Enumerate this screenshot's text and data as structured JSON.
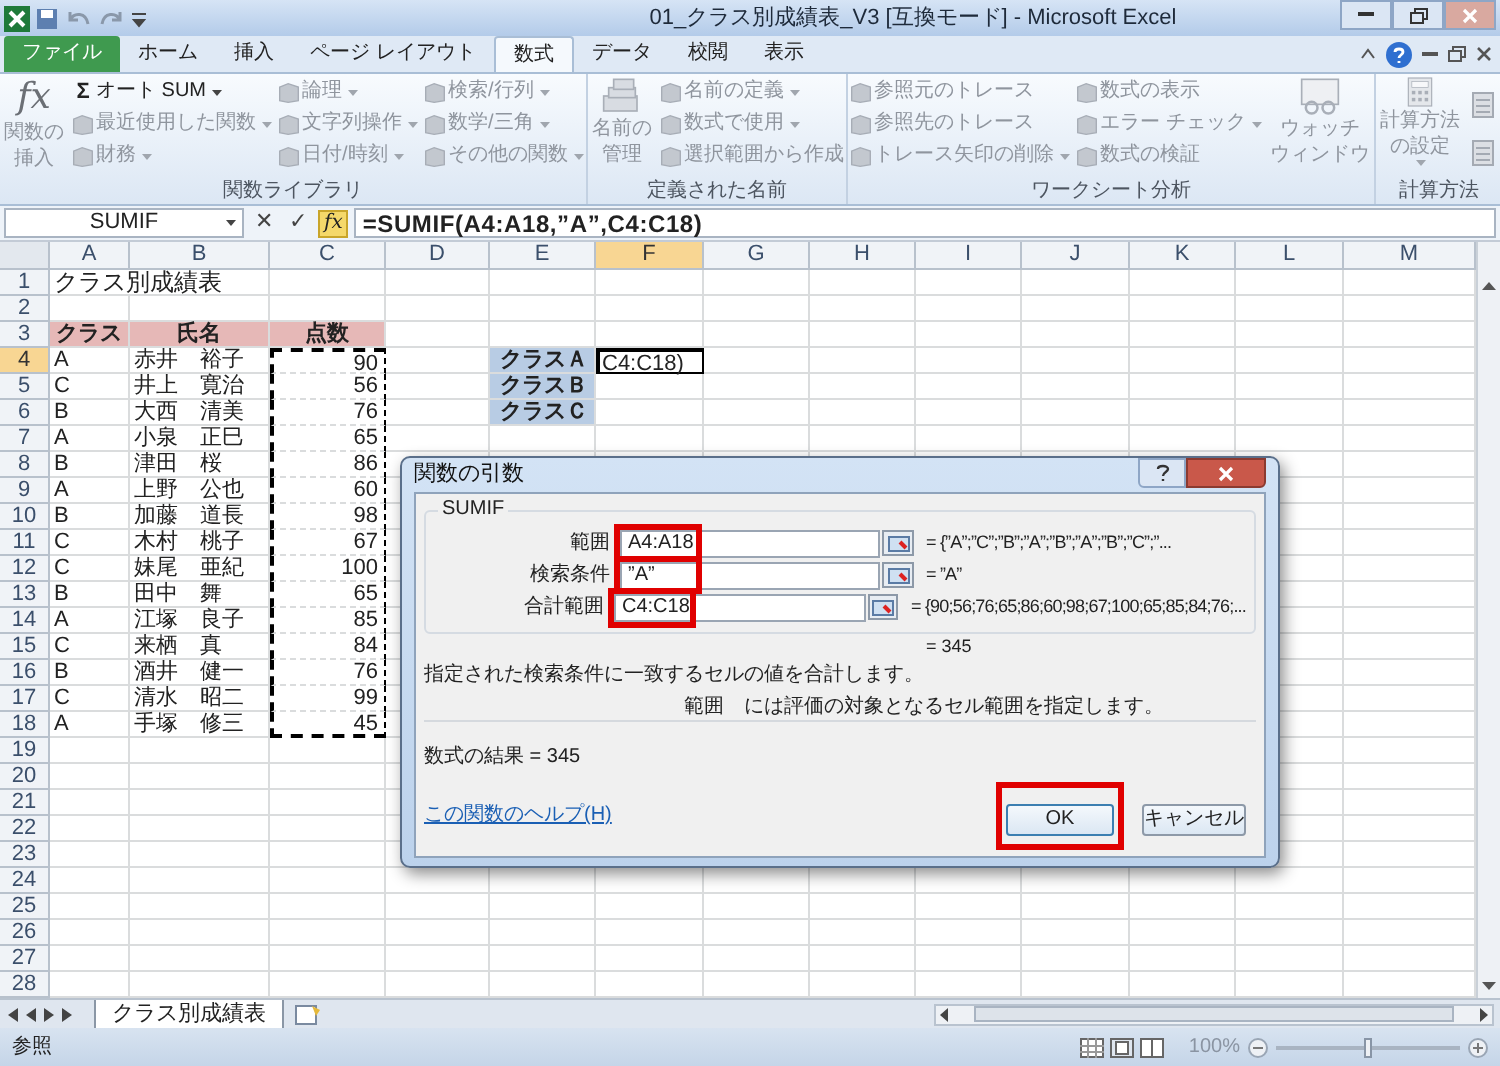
{
  "window": {
    "title": "01_クラス別成績表_V3 [互換モード] - Microsoft Excel"
  },
  "ribbon_tabs": [
    {
      "label": "ファイル",
      "kind": "file",
      "selected": false
    },
    {
      "label": "ホーム",
      "kind": "tab",
      "selected": false
    },
    {
      "label": "挿入",
      "kind": "tab",
      "selected": false
    },
    {
      "label": "ページ レイアウト",
      "kind": "tab",
      "selected": false
    },
    {
      "label": "数式",
      "kind": "tab",
      "selected": true
    },
    {
      "label": "データ",
      "kind": "tab",
      "selected": false
    },
    {
      "label": "校閲",
      "kind": "tab",
      "selected": false
    },
    {
      "label": "表示",
      "kind": "tab",
      "selected": false
    }
  ],
  "ribbon_groups": [
    {
      "label": "関数ライブラリ",
      "columns": [
        [
          {
            "kind": "function",
            "symbol": "fx",
            "label": [
              "関数の",
              "挿入"
            ],
            "disabled": true
          }
        ],
        [
          {
            "kind": "small",
            "symbol": "Σ",
            "label": "オート SUM",
            "dropdown": true,
            "disabled": false
          },
          {
            "kind": "small",
            "label": "最近使用した関数",
            "dropdown": true,
            "disabled": true
          },
          {
            "kind": "small",
            "label": "財務",
            "dropdown": true,
            "disabled": true
          }
        ],
        [
          {
            "kind": "small",
            "label": "論理",
            "dropdown": true,
            "disabled": true
          },
          {
            "kind": "small",
            "label": "文字列操作",
            "dropdown": true,
            "disabled": true
          },
          {
            "kind": "small",
            "label": "日付/時刻",
            "dropdown": true,
            "disabled": true
          }
        ],
        [
          {
            "kind": "small",
            "label": "検索/行列",
            "dropdown": true,
            "disabled": true
          },
          {
            "kind": "small",
            "label": "数学/三角",
            "dropdown": true,
            "disabled": true
          },
          {
            "kind": "small",
            "label": "その他の関数",
            "dropdown": true,
            "disabled": true
          }
        ]
      ]
    },
    {
      "label": "定義された名前",
      "columns": [
        [
          {
            "kind": "names",
            "label": [
              "名前の",
              "管理"
            ],
            "disabled": true
          }
        ],
        [
          {
            "kind": "small",
            "label": "名前の定義",
            "dropdown": true,
            "disabled": true
          },
          {
            "kind": "small",
            "label": "数式で使用",
            "dropdown": true,
            "disabled": true
          },
          {
            "kind": "small",
            "label": "選択範囲から作成",
            "disabled": true
          }
        ]
      ]
    },
    {
      "label": "ワークシート分析",
      "columns": [
        [
          {
            "kind": "small",
            "label": "参照元のトレース",
            "disabled": true
          },
          {
            "kind": "small",
            "label": "参照先のトレース",
            "disabled": true
          },
          {
            "kind": "small",
            "label": "トレース矢印の削除",
            "dropdown": true,
            "disabled": true
          }
        ],
        [
          {
            "kind": "small",
            "label": "数式の表示",
            "disabled": true
          },
          {
            "kind": "small",
            "label": "エラー チェック",
            "dropdown": true,
            "disabled": true
          },
          {
            "kind": "small",
            "label": "数式の検証",
            "disabled": true
          }
        ],
        [
          {
            "kind": "watch",
            "label": [
              "ウォッチ",
              "ウィンドウ"
            ],
            "disabled": true
          }
        ]
      ]
    },
    {
      "label": "計算方法",
      "columns": [
        [
          {
            "kind": "calculation",
            "label": "計算方法の設定",
            "dropdown": true,
            "disabled": true
          }
        ],
        [
          {
            "kind": "icon",
            "disabled": true
          },
          {
            "kind": "icon",
            "disabled": true
          }
        ]
      ]
    }
  ],
  "formula_bar": {
    "name_box": "SUMIF",
    "cancel_symbol": "✕",
    "enter_symbol": "✓",
    "function_symbol": "fx",
    "formula": "=SUMIF(A4:A18,”A”,C4:C18)"
  },
  "columns": [
    {
      "label": "A",
      "selected": false
    },
    {
      "label": "B",
      "selected": false
    },
    {
      "label": "C",
      "selected": false
    },
    {
      "label": "D",
      "selected": false
    },
    {
      "label": "E",
      "selected": false
    },
    {
      "label": "F",
      "selected": true
    },
    {
      "label": "G",
      "selected": false
    },
    {
      "label": "H",
      "selected": false
    },
    {
      "label": "I",
      "selected": false
    },
    {
      "label": "J",
      "selected": false
    },
    {
      "label": "K",
      "selected": false
    },
    {
      "label": "L",
      "selected": false
    },
    {
      "label": "M",
      "selected": false
    }
  ],
  "rows": [
    {
      "label": "1",
      "selected": false,
      "cells": {
        "A": {
          "text": "クラス別成績表",
          "kind": "title"
        }
      }
    },
    {
      "label": "2",
      "selected": false
    },
    {
      "label": "3",
      "selected": false,
      "cells": {
        "A": {
          "text": "クラス",
          "kind": "header"
        },
        "B": {
          "text": "氏名",
          "kind": "header"
        },
        "C": {
          "text": "点数",
          "kind": "header"
        }
      }
    },
    {
      "label": "4",
      "selected": true,
      "cells": {
        "A": {
          "text": "A",
          "kind": "text"
        },
        "B": {
          "text": "赤井　裕子",
          "kind": "text"
        },
        "C": {
          "text": "90",
          "kind": "number",
          "marquee": true
        },
        "E": {
          "text": "クラスＡ",
          "kind": "label"
        },
        "F": {
          "text": "C4:C18)",
          "kind": "editing"
        }
      }
    },
    {
      "label": "5",
      "selected": false,
      "cells": {
        "A": {
          "text": "C",
          "kind": "text"
        },
        "B": {
          "text": "井上　寛治",
          "kind": "text"
        },
        "C": {
          "text": "56",
          "kind": "number",
          "marquee": true
        },
        "E": {
          "text": "クラスＢ",
          "kind": "label"
        }
      }
    },
    {
      "label": "6",
      "selected": false,
      "cells": {
        "A": {
          "text": "B",
          "kind": "text"
        },
        "B": {
          "text": "大西　清美",
          "kind": "text"
        },
        "C": {
          "text": "76",
          "kind": "number",
          "marquee": true
        },
        "E": {
          "text": "クラスＣ",
          "kind": "label"
        }
      }
    },
    {
      "label": "7",
      "selected": false,
      "cells": {
        "A": {
          "text": "A",
          "kind": "text"
        },
        "B": {
          "text": "小泉　正巳",
          "kind": "text"
        },
        "C": {
          "text": "65",
          "kind": "number",
          "marquee": true
        }
      }
    },
    {
      "label": "8",
      "selected": false,
      "cells": {
        "A": {
          "text": "B",
          "kind": "text"
        },
        "B": {
          "text": "津田　桜",
          "kind": "text"
        },
        "C": {
          "text": "86",
          "kind": "number",
          "marquee": true
        }
      }
    },
    {
      "label": "9",
      "selected": false,
      "cells": {
        "A": {
          "text": "A",
          "kind": "text"
        },
        "B": {
          "text": "上野　公也",
          "kind": "text"
        },
        "C": {
          "text": "60",
          "kind": "number",
          "marquee": true
        }
      }
    },
    {
      "label": "10",
      "selected": false,
      "cells": {
        "A": {
          "text": "B",
          "kind": "text"
        },
        "B": {
          "text": "加藤　道長",
          "kind": "text"
        },
        "C": {
          "text": "98",
          "kind": "number",
          "marquee": true
        }
      }
    },
    {
      "label": "11",
      "selected": false,
      "cells": {
        "A": {
          "text": "C",
          "kind": "text"
        },
        "B": {
          "text": "木村　桃子",
          "kind": "text"
        },
        "C": {
          "text": "67",
          "kind": "number",
          "marquee": true
        }
      }
    },
    {
      "label": "12",
      "selected": false,
      "cells": {
        "A": {
          "text": "C",
          "kind": "text"
        },
        "B": {
          "text": "妹尾　亜紀",
          "kind": "text"
        },
        "C": {
          "text": "100",
          "kind": "number",
          "marquee": true
        }
      }
    },
    {
      "label": "13",
      "selected": false,
      "cells": {
        "A": {
          "text": "B",
          "kind": "text"
        },
        "B": {
          "text": "田中　舞",
          "kind": "text"
        },
        "C": {
          "text": "65",
          "kind": "number",
          "marquee": true
        }
      }
    },
    {
      "label": "14",
      "selected": false,
      "cells": {
        "A": {
          "text": "A",
          "kind": "text"
        },
        "B": {
          "text": "江塚　良子",
          "kind": "text"
        },
        "C": {
          "text": "85",
          "kind": "number",
          "marquee": true
        }
      }
    },
    {
      "label": "15",
      "selected": false,
      "cells": {
        "A": {
          "text": "C",
          "kind": "text"
        },
        "B": {
          "text": "来栖　真",
          "kind": "text"
        },
        "C": {
          "text": "84",
          "kind": "number",
          "marquee": true
        }
      }
    },
    {
      "label": "16",
      "selected": false,
      "cells": {
        "A": {
          "text": "B",
          "kind": "text"
        },
        "B": {
          "text": "酒井　健一",
          "kind": "text"
        },
        "C": {
          "text": "76",
          "kind": "number",
          "marquee": true
        }
      }
    },
    {
      "label": "17",
      "selected": false,
      "cells": {
        "A": {
          "text": "C",
          "kind": "text"
        },
        "B": {
          "text": "清水　昭二",
          "kind": "text"
        },
        "C": {
          "text": "99",
          "kind": "number",
          "marquee": true
        }
      }
    },
    {
      "label": "18",
      "selected": false,
      "cells": {
        "A": {
          "text": "A",
          "kind": "text"
        },
        "B": {
          "text": "手塚　修三",
          "kind": "text"
        },
        "C": {
          "text": "45",
          "kind": "number",
          "marquee": true
        }
      }
    },
    {
      "label": "19",
      "selected": false
    },
    {
      "label": "20",
      "selected": false
    },
    {
      "label": "21",
      "selected": false
    },
    {
      "label": "22",
      "selected": false
    },
    {
      "label": "23",
      "selected": false
    },
    {
      "label": "24",
      "selected": false
    },
    {
      "label": "25",
      "selected": false
    },
    {
      "label": "26",
      "selected": false
    },
    {
      "label": "27",
      "selected": false
    },
    {
      "label": "28",
      "selected": false
    }
  ],
  "dialog": {
    "title": "関数の引数",
    "function_name": "SUMIF",
    "arguments": [
      {
        "label": "範囲",
        "value": "A4:A18",
        "result": "= {”A”;”C”;”B”;”A”;”B”;”A”;”B”;”C”;”...",
        "highlighted": true
      },
      {
        "label": "検索条件",
        "value": "”A”",
        "result": "= ”A”",
        "highlighted": true
      },
      {
        "label": "合計範囲",
        "value": "C4:C18",
        "result": "= {90;56;76;65;86;60;98;67;100;65;85;84;76;...",
        "highlighted": true
      }
    ],
    "formula_value": "= 345",
    "description": "指定された検索条件に一致するセルの値を合計します。",
    "argument_name": "範囲",
    "argument_help": "には評価の対象となるセル範囲を指定します。",
    "result": "数式の結果 =  345",
    "help_link": "この関数のヘルプ(H)",
    "buttons": [
      {
        "label": "OK",
        "highlighted": true
      },
      {
        "label": "キャンセル",
        "highlighted": false
      }
    ]
  },
  "sheet_tabs": [
    {
      "label": "クラス別成績表",
      "selected": true
    }
  ],
  "status_bar": {
    "mode": "参照",
    "zoom": "100%",
    "zoom_slider": {
      "level": 0.5
    }
  }
}
